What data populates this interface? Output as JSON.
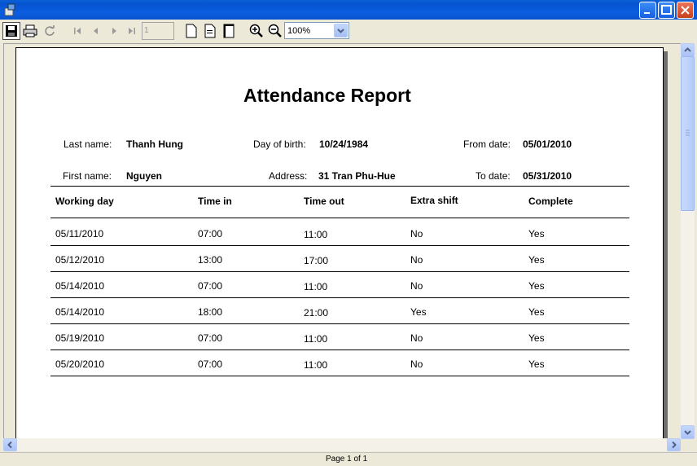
{
  "window": {
    "controls": [
      "minimize",
      "maximize",
      "close"
    ]
  },
  "toolbar": {
    "page_input": "1",
    "zoom": "100%"
  },
  "report": {
    "title": "Attendance Report",
    "fields": {
      "last_name_label": "Last name:",
      "last_name": "Thanh Hung",
      "first_name_label": "First name:",
      "first_name": "Nguyen",
      "dob_label": "Day of birth:",
      "dob": "10/24/1984",
      "address_label": "Address:",
      "address": "31 Tran Phu-Hue",
      "from_label": "From date:",
      "from": "05/01/2010",
      "to_label": "To date:",
      "to": "05/31/2010"
    },
    "columns": [
      "Working day",
      "Time in",
      "Time out",
      "Extra shift",
      "Complete"
    ],
    "rows": [
      [
        "05/11/2010",
        "07:00",
        "11:00",
        "No",
        "Yes"
      ],
      [
        "05/12/2010",
        "13:00",
        "17:00",
        "No",
        "Yes"
      ],
      [
        "05/14/2010",
        "07:00",
        "11:00",
        "No",
        "Yes"
      ],
      [
        "05/14/2010",
        "18:00",
        "21:00",
        "Yes",
        "Yes"
      ],
      [
        "05/19/2010",
        "07:00",
        "11:00",
        "No",
        "Yes"
      ],
      [
        "05/20/2010",
        "07:00",
        "11:00",
        "No",
        "Yes"
      ]
    ]
  },
  "status": {
    "page_text": "Page 1 of 1"
  }
}
